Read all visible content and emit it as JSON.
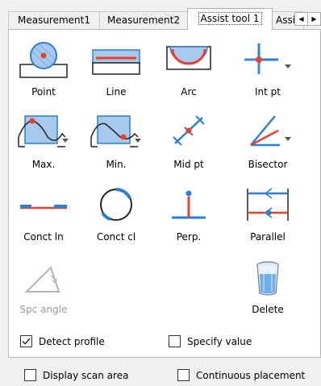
{
  "tabs": [
    {
      "label": "Measurement1"
    },
    {
      "label": "Measurement2"
    },
    {
      "label": "Assist tool 1"
    },
    {
      "label": "Assi"
    }
  ],
  "tab_scroll": {
    "left": "◀",
    "right": "▶"
  },
  "tools": {
    "point": "Point",
    "line": "Line",
    "arc": "Arc",
    "int_pt": "Int pt",
    "max": "Max.",
    "min": "Min.",
    "mid_pt": "Mid pt",
    "bisector": "Bisector",
    "conct_ln": "Conct ln",
    "conct_cl": "Conct cl",
    "perp": "Perp.",
    "parallel": "Parallel",
    "spc_angle": "Spc angle",
    "delete": "Delete"
  },
  "options": {
    "detect_profile": {
      "label": "Detect profile",
      "checked": true
    },
    "specify_value": {
      "label": "Specify value",
      "checked": false
    },
    "display_scan_area": {
      "label": "Display scan area",
      "checked": false
    },
    "continuous_placement": {
      "label": "Continuous placement",
      "checked": false
    }
  },
  "colors": {
    "accent_blue": "#2b7fd4",
    "accent_red": "#e8412c",
    "disabled_gray": "#9a9a9a"
  }
}
